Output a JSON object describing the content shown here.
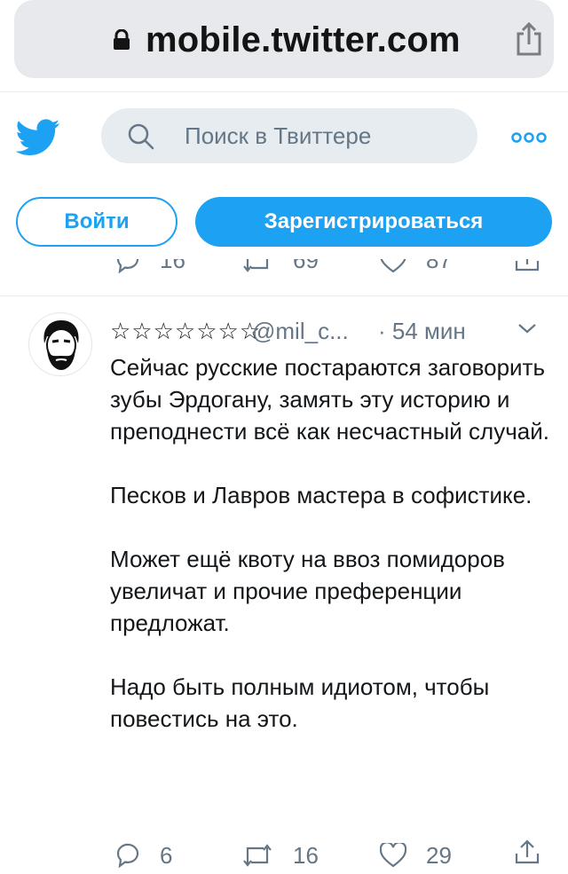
{
  "browser": {
    "url": "mobile.twitter.com"
  },
  "header": {
    "search_placeholder": "Поиск в Твиттере",
    "login_label": "Войти",
    "signup_label": "Зарегистрироваться"
  },
  "prev_tweet": {
    "replies": "16",
    "retweets": "69",
    "likes": "87"
  },
  "tweet": {
    "name": "☆☆☆☆☆☆☆",
    "handle": "@mil_c...",
    "time": "· 54 мин",
    "text": "Сейчас русские постараются заговорить зубы Эрдогану, замять эту историю и преподнести всё как несчастный случай.\n\nПесков и Лавров мастера в софистике.\n\nМожет ещё квоту на ввоз помидоров увеличат и прочие преференции предложат.\n\nНадо быть полным идиотом, чтобы повестись на это.",
    "replies": "6",
    "retweets": "16",
    "likes": "29"
  },
  "colors": {
    "brand": "#1da1f2",
    "muted": "#657786",
    "text": "#14171a"
  },
  "icons": [
    "lock-icon",
    "share-icon",
    "twitter-bird-icon",
    "search-icon",
    "more-icon",
    "reply-icon",
    "retweet-icon",
    "like-icon",
    "chevron-down-icon"
  ]
}
